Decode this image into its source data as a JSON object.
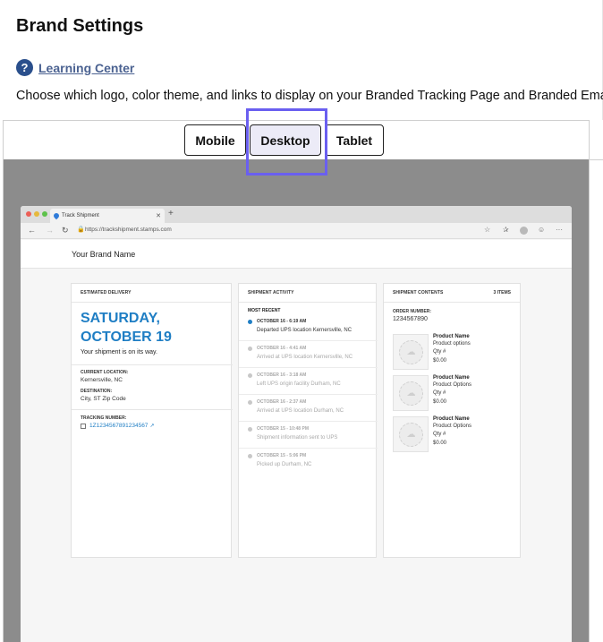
{
  "header": {
    "title": "Brand Settings",
    "help_icon": "question-circle-icon",
    "help_link": "Learning Center",
    "description": "Choose which logo, color theme, and links to display on your Branded Tracking Page and Branded Emails."
  },
  "tabs": [
    {
      "label": "Mobile"
    },
    {
      "label": "Desktop",
      "selected": true
    },
    {
      "label": "Tablet"
    }
  ],
  "browser": {
    "tab_title": "Track Shipment",
    "url": "https://trackshipment.stamps.com"
  },
  "site": {
    "brand_name": "Your Brand Name"
  },
  "delivery": {
    "header": "ESTIMATED DELIVERY",
    "date_line1": "SATURDAY,",
    "date_line2": "OCTOBER 19",
    "status": "Your shipment is on its way.",
    "current_location_label": "CURRENT LOCATION:",
    "current_location": "Kernersville, NC",
    "destination_label": "DESTINATION:",
    "destination": "City, ST Zip Code",
    "tracking_label": "TRACKING NUMBER:",
    "tracking_number": "1Z1234567891234567"
  },
  "activity": {
    "header": "SHIPMENT ACTIVITY",
    "most_recent_label": "MOST RECENT",
    "events": [
      {
        "time": "OCTOBER 16 - 6:19 AM",
        "desc": "Departed UPS location Kernersville, NC"
      },
      {
        "time": "OCTOBER 16 - 4:41 AM",
        "desc": "Arrived at UPS location Kernersville, NC"
      },
      {
        "time": "OCTOBER 16 - 3:18 AM",
        "desc": "Left UPS origin facility Durham, NC"
      },
      {
        "time": "OCTOBER 16 - 2:37 AM",
        "desc": "Arrived at UPS location Durham, NC"
      },
      {
        "time": "OCTOBER 15 - 10:48 PM",
        "desc": "Shipment information sent to UPS"
      },
      {
        "time": "OCTOBER 15 - 5:06 PM",
        "desc": "Picked up Durham, NC"
      }
    ]
  },
  "contents": {
    "header": "SHIPMENT CONTENTS",
    "count": "3 ITEMS",
    "order_label": "ORDER NUMBER:",
    "order_number": "1234567890",
    "products": [
      {
        "name": "Product Name",
        "options": "Product options",
        "qty": "Qty #",
        "price": "$0.00"
      },
      {
        "name": "Product Name",
        "options": "Product Options",
        "qty": "Qty #",
        "price": "$0.00"
      },
      {
        "name": "Product Name",
        "options": "Product Options",
        "qty": "Qty #",
        "price": "$0.00"
      }
    ]
  },
  "colors": {
    "accent_blue": "#1f7ec4",
    "focus_ring": "#6a5ff0",
    "preview_bg": "#8c8c8c"
  }
}
